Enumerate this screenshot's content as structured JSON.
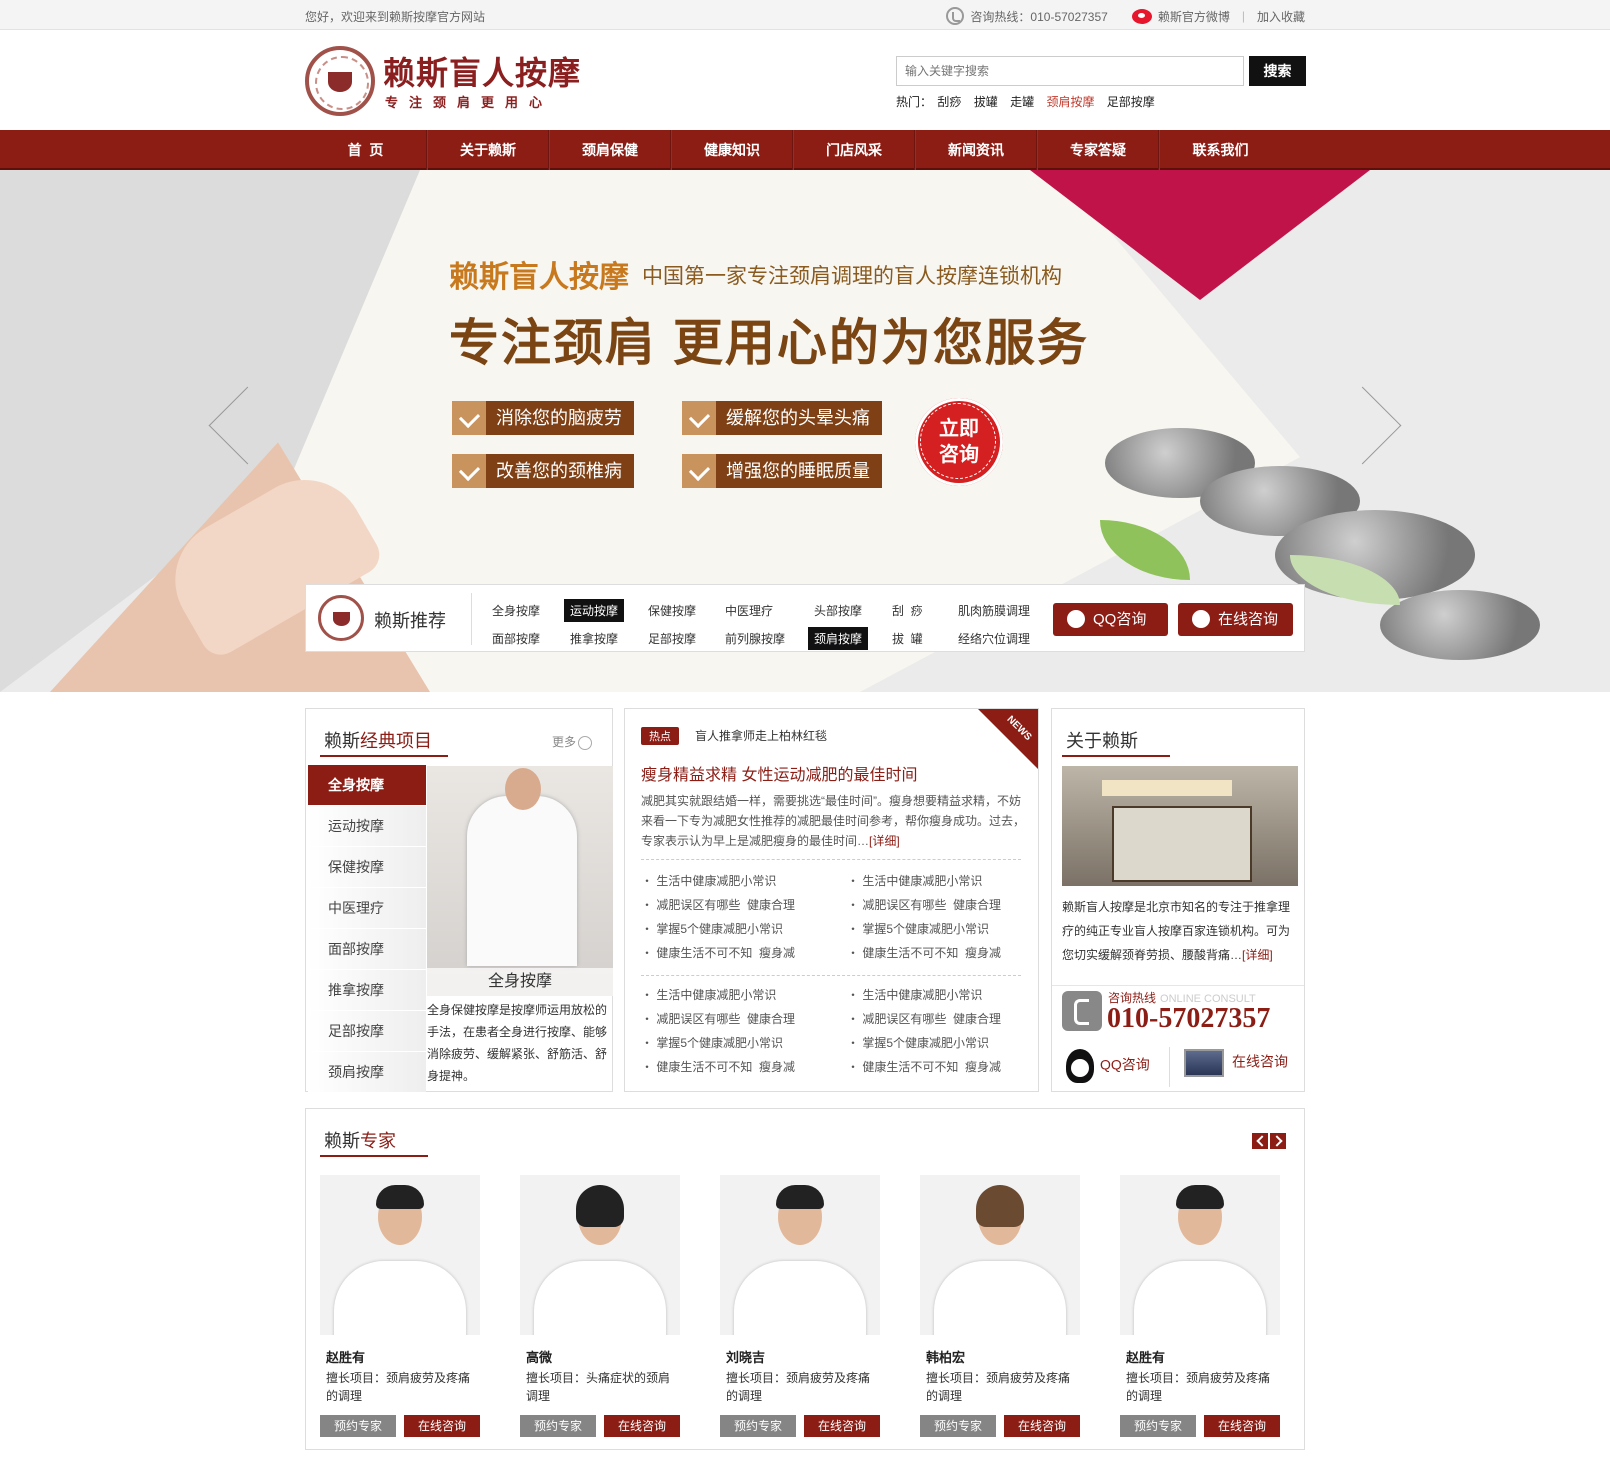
{
  "topbar": {
    "welcome": "您好，欢迎来到赖斯按摩官方网站",
    "hotline": "咨询热线：010-57027357",
    "weibo": "赖斯官方微博",
    "favorite": "加入收藏"
  },
  "logo": {
    "name": "赖斯盲人按摩",
    "slogan": "专注颈肩更用心"
  },
  "search": {
    "placeholder": "输入关键字搜索",
    "button": "搜索",
    "hot_label": "热门：",
    "hot": [
      "刮痧",
      "拔罐",
      "走罐",
      "颈肩按摩",
      "足部按摩"
    ]
  },
  "nav": [
    "首  页",
    "关于赖斯",
    "颈肩保健",
    "健康知识",
    "门店风采",
    "新闻资讯",
    "专家答疑",
    "联系我们"
  ],
  "banner": {
    "brand": "赖斯盲人按摩",
    "tagline": "中国第一家专注颈肩调理的盲人按摩连锁机构",
    "headline": "专注颈肩 更用心的为您服务",
    "benefits": [
      "消除您的脑疲劳",
      "缓解您的头晕头痛",
      "改善您的颈椎病",
      "增强您的睡眠质量"
    ],
    "stamp_line1": "立即",
    "stamp_line2": "咨询"
  },
  "recommend": {
    "title": "赖斯推荐",
    "tags": [
      "全身按摩",
      "运动按摩",
      "保健按摩",
      "中医理疗",
      "头部按摩",
      "刮  痧",
      "肌肉筋膜调理",
      "面部按摩",
      "推拿按摩",
      "足部按摩",
      "前列腺按摩",
      "颈肩按摩",
      "拔  罐",
      "经络穴位调理"
    ],
    "qq": "QQ咨询",
    "online": "在线咨询"
  },
  "classic": {
    "title_a": "赖斯",
    "title_b": "经典项目",
    "more": "更多",
    "menu": [
      "全身按摩",
      "运动按摩",
      "保健按摩",
      "中医理疗",
      "面部按摩",
      "推拿按摩",
      "足部按摩",
      "颈肩按摩"
    ],
    "caption": "全身按摩",
    "desc": "全身保健按摩是按摩师运用放松的手法，在患者全身进行按摩、能够消除疲劳、缓解紧张、舒筋活、舒身提神。"
  },
  "news": {
    "hot_tag": "热点",
    "hot_title": "盲人推拿师走上柏林红毯",
    "corner": "NEWS",
    "headline": "瘦身精益求精 女性运动减肥的最佳时间",
    "summary": "减肥其实就跟结婚一样，需要挑选“最佳时间”。瘦身想要精益求精，不妨来看一下专为减肥女性推荐的减肥最佳时间参考，帮你瘦身成功。过去，专家表示认为早上是减肥瘦身的最佳时间…",
    "detail": "[详细]",
    "items": [
      "生活中健康减肥小常识",
      "减肥误区有哪些  健康合理",
      "掌握5个健康减肥小常识",
      "健康生活不可不知  瘦身减"
    ]
  },
  "about": {
    "title": "关于赖斯",
    "text": "赖斯盲人按摩是北京市知名的专注于推拿理疗的纯正专业盲人按摩百家连锁机构。可为您切实缓解颈脊劳损、腰酸背痛…",
    "detail": "[详细]",
    "hotline_label": "咨询热线",
    "hotline_en": "ONLINE CONSULT",
    "phone": "010-57027357",
    "qq": "QQ咨询",
    "online": "在线咨询"
  },
  "experts": {
    "title_a": "赖斯",
    "title_b": "专家",
    "book": "预约专家",
    "consult": "在线咨询",
    "list": [
      {
        "name": "赵胜有",
        "skill": "擅长项目：颈肩疲劳及疼痛的调理"
      },
      {
        "name": "高微",
        "skill": "擅长项目：头痛症状的颈肩调理"
      },
      {
        "name": "刘晓吉",
        "skill": "擅长项目：颈肩疲劳及疼痛的调理"
      },
      {
        "name": "韩柏宏",
        "skill": "擅长项目：颈肩疲劳及疼痛的调理"
      },
      {
        "name": "赵胜有",
        "skill": "擅长项目：颈肩疲劳及疼痛的调理"
      }
    ]
  },
  "colors": {
    "brand": "#8b1d15",
    "accent": "#c0134a",
    "gold": "#7e4014"
  }
}
